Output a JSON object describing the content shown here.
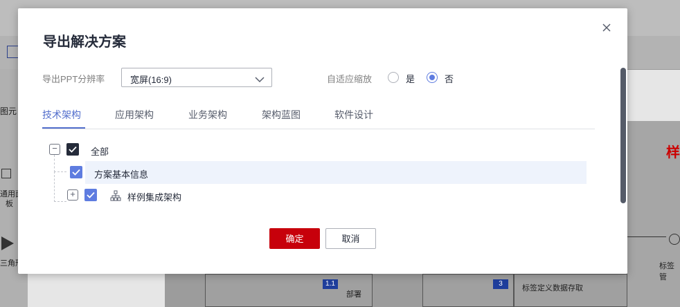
{
  "dialog": {
    "title": "导出解决方案",
    "resolution_label": "导出PPT分辨率",
    "resolution_value": "宽屏(16:9)",
    "adaptive_label": "自适应缩放",
    "radio_yes": "是",
    "radio_no": "否",
    "radio_selected": "否"
  },
  "tabs": [
    {
      "label": "技术架构",
      "active": true
    },
    {
      "label": "应用架构",
      "active": false
    },
    {
      "label": "业务架构",
      "active": false
    },
    {
      "label": "架构蓝图",
      "active": false
    },
    {
      "label": "软件设计",
      "active": false
    }
  ],
  "tree": {
    "root": {
      "label": "全部",
      "checked": true,
      "expanded": true
    },
    "child1": {
      "label": "方案基本信息",
      "checked": true
    },
    "child2": {
      "label": "样例集成架构",
      "checked": true,
      "expanded": false,
      "icon": "hierarchy-icon"
    }
  },
  "buttons": {
    "confirm": "确定",
    "cancel": "取消"
  },
  "background": {
    "left_text1": "图元",
    "left_text2": "通用面",
    "left_text3": "板",
    "left_text4": "三角形",
    "badge1": "1.1",
    "cell1": "部署",
    "badge2": "3",
    "cell2": "标签定义数据存取",
    "right_text": "标签管",
    "right_red": "样"
  },
  "colors": {
    "accent": "#526ecc",
    "primary_button": "#c7000b",
    "checkbox_dark": "#252b3a",
    "checkbox_blue": "#5e7ce0"
  }
}
